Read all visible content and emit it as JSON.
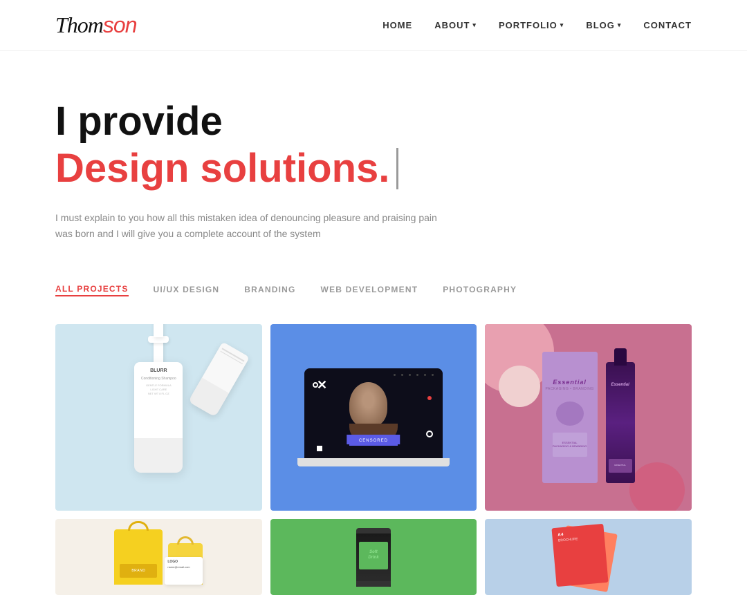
{
  "logo": {
    "text_black": "Thomson",
    "text_accent": "on"
  },
  "nav": {
    "items": [
      {
        "label": "HOME",
        "has_dropdown": false
      },
      {
        "label": "ABOUT",
        "has_dropdown": true
      },
      {
        "label": "PORTFOLIO",
        "has_dropdown": true
      },
      {
        "label": "BLOG",
        "has_dropdown": true
      },
      {
        "label": "CONTACT",
        "has_dropdown": false
      }
    ]
  },
  "hero": {
    "title_normal": "I provide",
    "title_accent": "Design solutions.",
    "description_line1": "I must explain to you how all this mistaken idea of denouncing pleasure and praising pain",
    "description_line2": "was born and I will give you a complete account of the system"
  },
  "filter_tabs": {
    "items": [
      {
        "label": "ALL PROJECTS",
        "active": true
      },
      {
        "label": "UI/UX DESIGN",
        "active": false
      },
      {
        "label": "BRANDING",
        "active": false
      },
      {
        "label": "WEB DEVELOPMENT",
        "active": false
      },
      {
        "label": "PHOTOGRAPHY",
        "active": false
      }
    ]
  },
  "portfolio": {
    "row1": [
      {
        "id": "proj-1",
        "bg_color": "#d0e8f0",
        "alt": "Conditioning Shampoo Product"
      },
      {
        "id": "proj-2",
        "bg_color": "#5b8ee6",
        "alt": "Censored UI Design"
      },
      {
        "id": "proj-3",
        "bg_color": "#d4879b",
        "alt": "Essential Packaging Branding"
      }
    ],
    "row2": [
      {
        "id": "proj-4",
        "bg_color": "#f5f0e8",
        "alt": "Yellow Bag Branding"
      },
      {
        "id": "proj-5",
        "bg_color": "#5cb85c",
        "alt": "SoftDrink Can Design"
      },
      {
        "id": "proj-6",
        "bg_color": "#c0d8f0",
        "alt": "A4 Brochure Design"
      }
    ]
  },
  "colors": {
    "accent": "#e84040",
    "nav_text": "#333333",
    "muted": "#888888"
  }
}
